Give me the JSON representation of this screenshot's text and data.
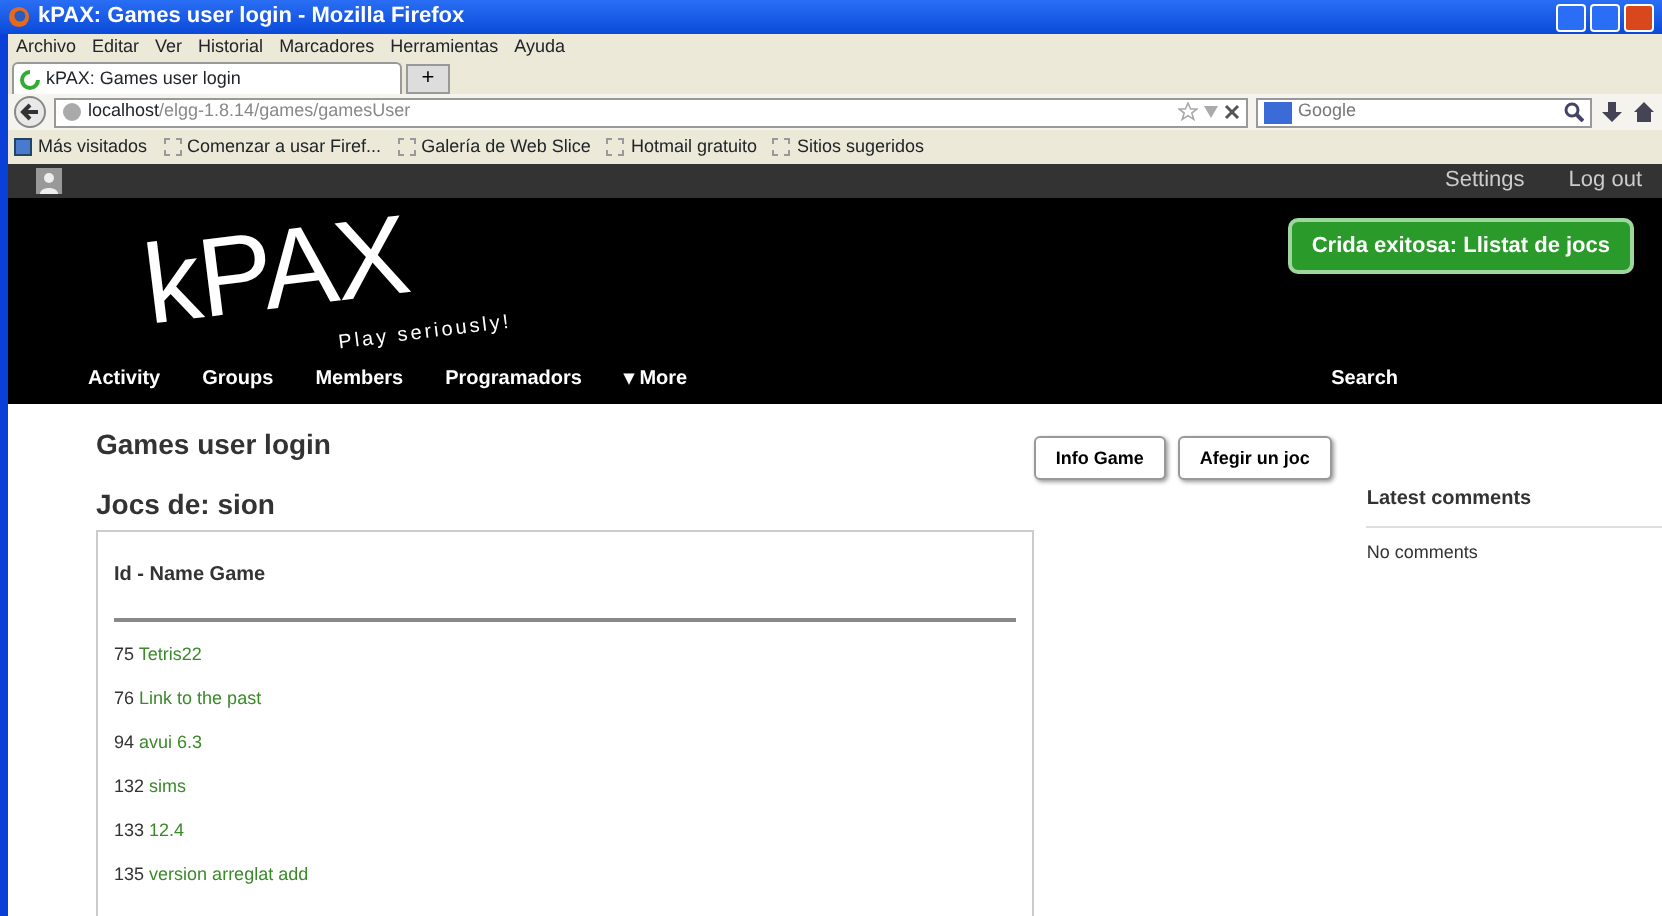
{
  "window": {
    "title": "kPAX: Games user login - Mozilla Firefox"
  },
  "menu": [
    "Archivo",
    "Editar",
    "Ver",
    "Historial",
    "Marcadores",
    "Herramientas",
    "Ayuda"
  ],
  "tabs": [
    {
      "label": "kPAX: Games user login",
      "selected": true
    }
  ],
  "new_tab": "+",
  "address": {
    "host": "localhost",
    "path": "/elgg-1.8.14/games/gamesUser"
  },
  "search_engine": {
    "placeholder": "Google"
  },
  "bookmarks": [
    "Más visitados",
    "Comenzar a usar Firef...",
    "Galería de Web Slice",
    "Hotmail gratuito",
    "Sitios sugeridos"
  ],
  "topbar": {
    "links": [
      "Settings",
      "Log out"
    ]
  },
  "header": {
    "logo": "kPAX",
    "tagline": "Play seriously!",
    "message": "Crida exitosa: Llistat de jocs"
  },
  "nav": {
    "items": [
      "Activity",
      "Groups",
      "Members",
      "Programadors",
      "▾ More"
    ],
    "search": "Search"
  },
  "content": {
    "title": "Games user login",
    "buttons": [
      "Info Game",
      "Afegir un joc"
    ],
    "subtitle": "Jocs de: sion",
    "table": {
      "heading": "Id - Name Game",
      "rows": [
        {
          "id": "75",
          "name": "Tetris22"
        },
        {
          "id": "76",
          "name": "Link to the past"
        },
        {
          "id": "94",
          "name": "avui 6.3"
        },
        {
          "id": "132",
          "name": "sims"
        },
        {
          "id": "133",
          "name": "12.4"
        },
        {
          "id": "135",
          "name": "version arreglat add"
        }
      ]
    }
  },
  "sidebar": {
    "title": "Latest comments",
    "text": "No comments"
  }
}
